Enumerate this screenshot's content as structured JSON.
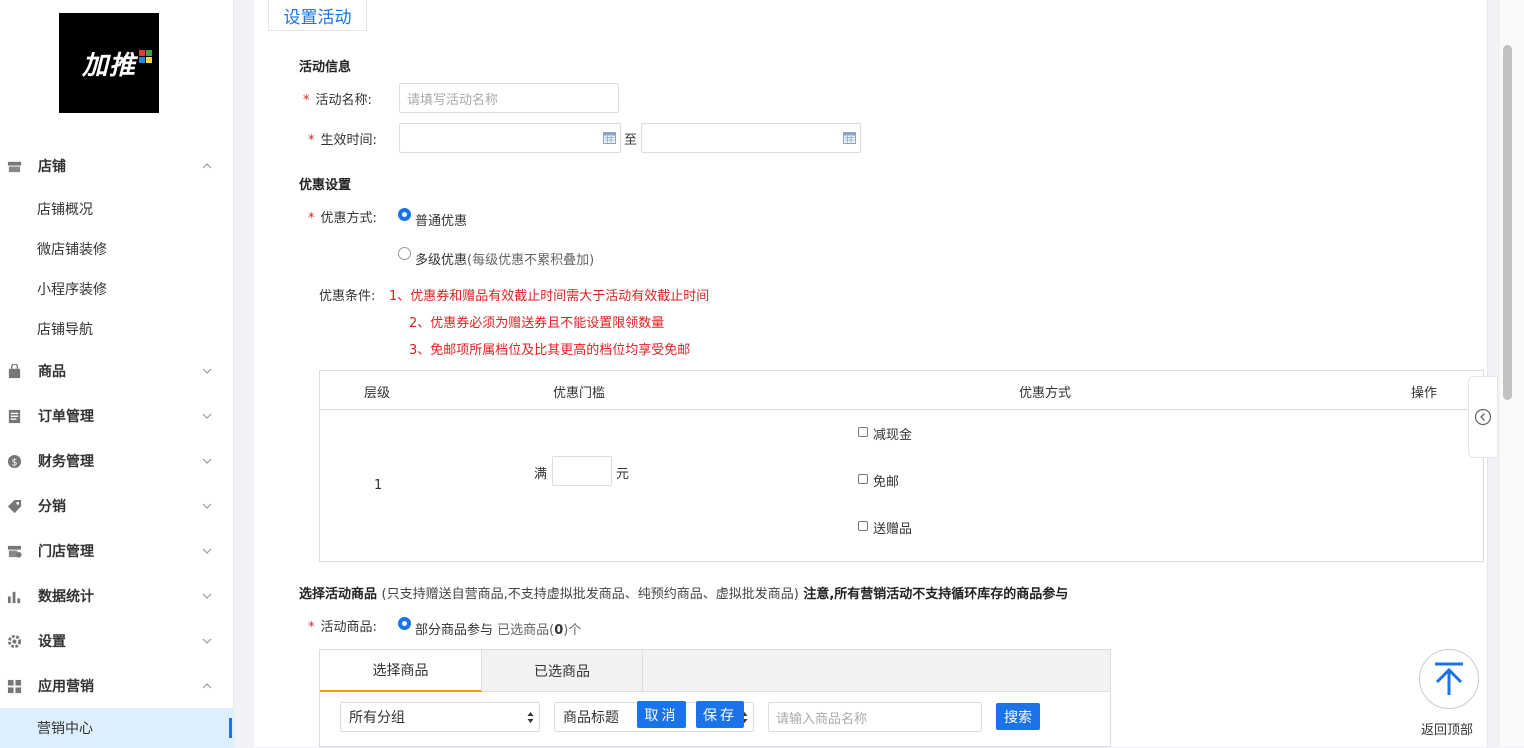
{
  "brand": {
    "logo_text": "加推"
  },
  "sidebar": {
    "groups": [
      {
        "label": "店铺",
        "icon": "store-icon"
      },
      {
        "label": "商品",
        "icon": "bag-icon"
      },
      {
        "label": "订单管理",
        "icon": "document-icon"
      },
      {
        "label": "财务管理",
        "icon": "currency-icon"
      },
      {
        "label": "分销",
        "icon": "tag-icon"
      },
      {
        "label": "门店管理",
        "icon": "shop-settings-icon"
      },
      {
        "label": "数据统计",
        "icon": "bar-chart-icon"
      },
      {
        "label": "设置",
        "icon": "gear-icon"
      },
      {
        "label": "应用营销",
        "icon": "apps-grid-icon"
      }
    ],
    "store_items": [
      "店铺概况",
      "微店铺装修",
      "小程序装修",
      "店铺导航"
    ],
    "marketing_items": [
      "营销中心"
    ]
  },
  "page": {
    "tab_title": "设置活动",
    "activity_info": {
      "section_title": "活动信息",
      "name_label": "活动名称:",
      "name_placeholder": "请填写活动名称",
      "time_label": "生效时间:",
      "to_label": "至",
      "required_mark": "*"
    },
    "discount": {
      "section_title": "优惠设置",
      "mode_label": "优惠方式:",
      "option_normal": "普通优惠",
      "option_multi": "多级优惠",
      "option_multi_note": "(每级优惠不累积叠加)",
      "condition_label": "优惠条件:",
      "conditions": [
        "1、优惠券和赠品有效截止时间需大于活动有效截止时间",
        "2、优惠券必须为赠送券且不能设置限领数量",
        "3、免邮项所属档位及比其更高的档位均享受免邮"
      ],
      "table": {
        "headers": [
          "层级",
          "优惠门槛",
          "优惠方式",
          "操作"
        ],
        "row_level": "1",
        "threshold_prefix": "满",
        "threshold_suffix": "元",
        "methods": [
          "减现金",
          "免邮",
          "送赠品"
        ]
      }
    },
    "goods": {
      "section_title": "选择活动商品",
      "section_note": "(只支持赠送自营商品,不支持虚拟批发商品、纯预约商品、虚拟批发商品)",
      "section_warning": "注意,所有营销活动不支持循环库存的商品参与",
      "goods_label": "活动商品:",
      "partial_option": "部分商品参与",
      "selected_count_prefix": "已选商品(",
      "selected_count": "0",
      "selected_count_suffix": ")个",
      "tabs": [
        "选择商品",
        "已选商品"
      ],
      "group_select": "所有分组",
      "field_select": "商品标题",
      "cancel_button": "取消",
      "save_button": "保存",
      "search_placeholder": "请输入商品名称",
      "search_button": "搜索"
    },
    "back_to_top": "返回顶部"
  },
  "colors": {
    "accent": "#1a73e8",
    "required": "#e02020",
    "tab_underline": "#f39800"
  }
}
